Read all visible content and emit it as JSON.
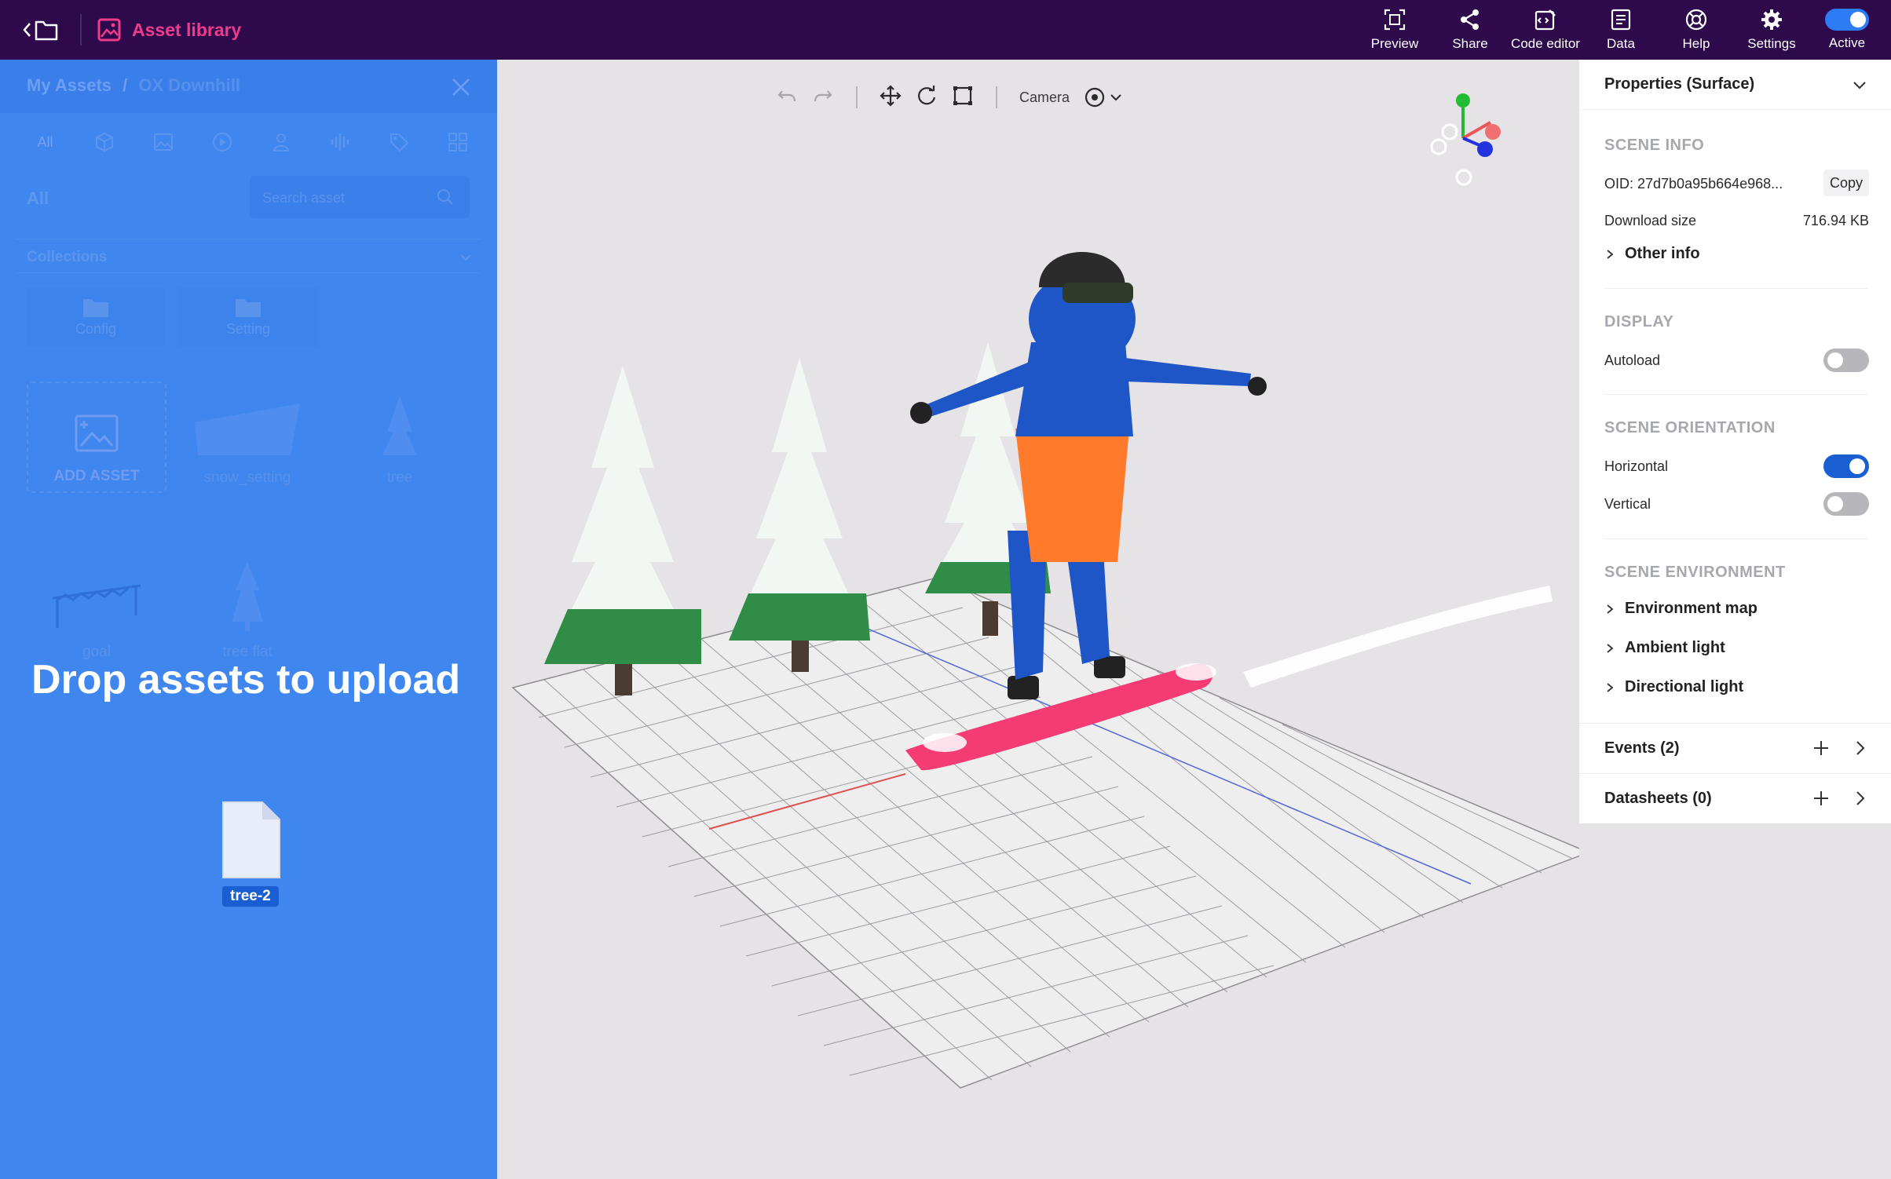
{
  "topbar": {
    "library_label": "Asset library",
    "actions": [
      {
        "label": "Preview",
        "icon": "preview-icon"
      },
      {
        "label": "Share",
        "icon": "share-icon"
      },
      {
        "label": "Code editor",
        "icon": "code-editor-icon"
      },
      {
        "label": "Data",
        "icon": "data-icon"
      },
      {
        "label": "Help",
        "icon": "help-icon"
      },
      {
        "label": "Settings",
        "icon": "gear-icon"
      },
      {
        "label": "Active",
        "icon": "toggle",
        "on": true
      }
    ]
  },
  "asset_panel": {
    "breadcrumb_root": "My Assets",
    "breadcrumb_sep": "/",
    "breadcrumb_current": "OX Downhill",
    "tabs": [
      "All",
      "3d-model",
      "image",
      "video",
      "avatar",
      "audio",
      "tag",
      "grid"
    ],
    "filter_label": "All",
    "search_placeholder": "Search asset",
    "collections_label": "Collections",
    "folders": [
      "Config",
      "Setting"
    ],
    "add_asset_label": "ADD ASSET",
    "assets": [
      "snow_setting",
      "tree",
      "goal",
      "tree flat"
    ],
    "drop_message": "Drop assets to upload",
    "dragged_file": "tree-2"
  },
  "viewport": {
    "camera_label": "Camera"
  },
  "properties": {
    "title": "Properties (Surface)",
    "scene_info": {
      "heading": "SCENE INFO",
      "oid_label": "OID: 27d7b0a95b664e968...",
      "copy_label": "Copy",
      "download_label": "Download size",
      "download_value": "716.94 KB",
      "other_info": "Other info"
    },
    "display": {
      "heading": "DISPLAY",
      "autoload_label": "Autoload",
      "autoload_on": false
    },
    "orientation": {
      "heading": "SCENE ORIENTATION",
      "horizontal_label": "Horizontal",
      "horizontal_on": true,
      "vertical_label": "Vertical",
      "vertical_on": false
    },
    "environment": {
      "heading": "SCENE ENVIRONMENT",
      "items": [
        "Environment map",
        "Ambient light",
        "Directional light"
      ]
    },
    "events_label": "Events (2)",
    "datasheets_label": "Datasheets (0)"
  }
}
